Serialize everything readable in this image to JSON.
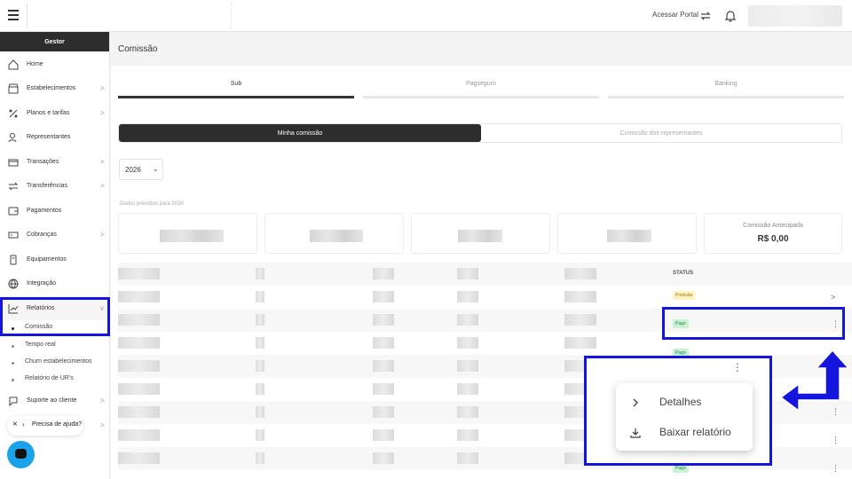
{
  "topbar": {
    "portal_label": "Acessar Portal",
    "icons": [
      "menu-icon",
      "swap-icon",
      "bell-icon"
    ]
  },
  "sidebar": {
    "header": "Gestor",
    "items": [
      {
        "label": "Home",
        "icon": "home-icon"
      },
      {
        "label": "Estabelecimentos",
        "icon": "store-icon",
        "chevron": ">"
      },
      {
        "label": "Planos e tarifas",
        "icon": "percent-icon",
        "chevron": ">"
      },
      {
        "label": "Representantes",
        "icon": "person-icon"
      },
      {
        "label": "Transações",
        "icon": "card-icon",
        "chevron": ">"
      },
      {
        "label": "Transferências",
        "icon": "transfer-icon",
        "chevron": ">"
      },
      {
        "label": "Pagamentos",
        "icon": "payment-icon"
      },
      {
        "label": "Cobranças",
        "icon": "billing-icon",
        "chevron": ">"
      },
      {
        "label": "Equipamentos",
        "icon": "pos-icon"
      },
      {
        "label": "Integração",
        "icon": "globe-icon"
      },
      {
        "label": "Relatórios",
        "icon": "chart-icon",
        "chevron": "v"
      }
    ],
    "subitems": [
      "Comissão",
      "Tempo real",
      "Churn estabelecimentos",
      "Relatório de UR's"
    ],
    "support": {
      "label": "Suporte ao cliente",
      "icon": "support-icon",
      "chevron": ">"
    },
    "help": {
      "close": "×",
      "arrow": "›",
      "label": "Precisa de ajuda?"
    }
  },
  "main": {
    "title": "Comissão",
    "tabs": [
      "Sub",
      "Pagseguro",
      "Banking"
    ],
    "segments": [
      "Minha comissão",
      "Comissão dos representantes"
    ],
    "year": "2026",
    "year_chevron": "⌄",
    "caption": "Dados previstos para 2026",
    "kpi_anticipated": {
      "title": "Comissão Antecipada",
      "value": "R$ 0,00"
    },
    "status_header": "STATUS",
    "statuses": [
      "Previsão",
      "Pago",
      "Pago",
      "Pago"
    ],
    "row_chevron": ">",
    "kebab": "⋮"
  },
  "dropdown": {
    "items": [
      {
        "label": "Detalhes",
        "icon": "chevron-right-icon"
      },
      {
        "label": "Baixar relatório",
        "icon": "download-icon"
      }
    ]
  },
  "colors": {
    "highlight": "#1515e0",
    "dark": "#2d2d2d",
    "chat": "#1aa3e8"
  }
}
